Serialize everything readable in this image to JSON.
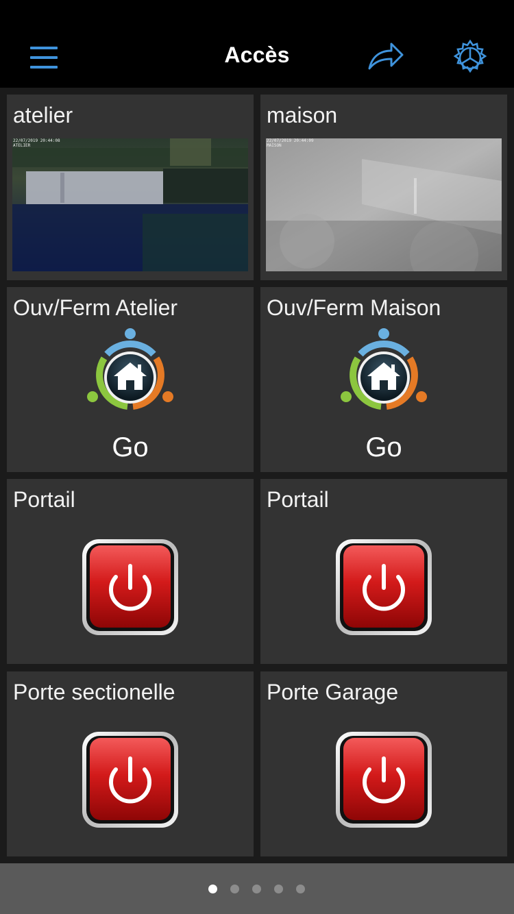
{
  "header": {
    "title": "Accès",
    "menu_icon": "hamburger-menu-icon",
    "share_icon": "share-arrow-icon",
    "settings_icon": "gear-icon",
    "accent_color": "#3f93dc"
  },
  "tiles": {
    "cam_atelier": {
      "label": "atelier",
      "stamp": "22/07/2019 20:44:08\nATELIER",
      "icon": "camera-feed"
    },
    "cam_maison": {
      "label": "maison",
      "stamp": "22/07/2019 20:44:09\nMAISON",
      "icon": "camera-feed"
    },
    "scene_atelier": {
      "label": "Ouv/Ferm Atelier",
      "action": "Go",
      "icon": "home-scene-icon"
    },
    "scene_maison": {
      "label": "Ouv/Ferm Maison",
      "action": "Go",
      "icon": "home-scene-icon"
    },
    "switch_portail_1": {
      "label": "Portail",
      "icon": "power-icon"
    },
    "switch_portail_2": {
      "label": "Portail",
      "icon": "power-icon"
    },
    "switch_sectionelle": {
      "label": "Porte sectionelle",
      "icon": "power-icon"
    },
    "switch_garage": {
      "label": "Porte Garage",
      "icon": "power-icon"
    }
  },
  "pager": {
    "pages": 5,
    "current": 1
  },
  "colors": {
    "tile_bg": "#333333",
    "power_red": "#d11a1a",
    "ring_blue": "#6ab0e0",
    "ring_orange": "#e57a25",
    "ring_green": "#8cc63f"
  }
}
